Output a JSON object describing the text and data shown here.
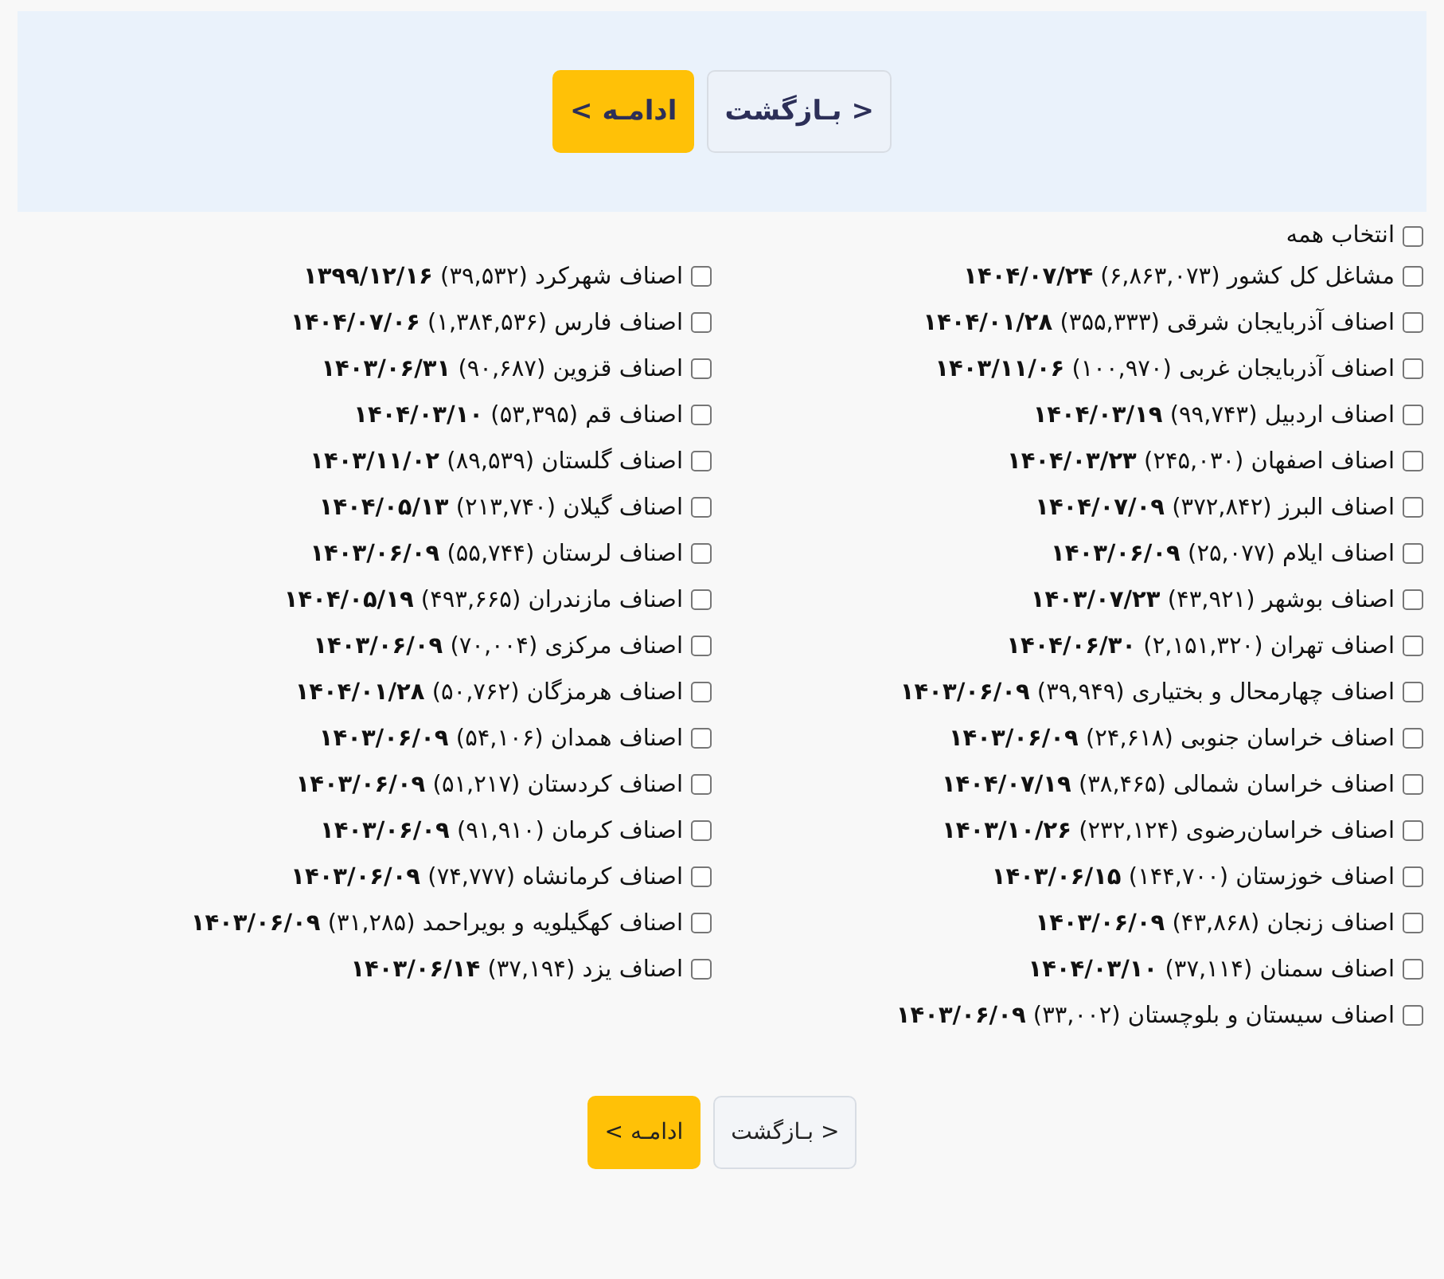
{
  "top_actions": [
    {
      "kind": "back",
      "label": "< بـازگشت"
    },
    {
      "kind": "continue",
      "label": "ادامـه >"
    }
  ],
  "select_all": {
    "label": "انتخاب همه",
    "checked": false
  },
  "columns": [
    {
      "items": [
        {
          "text": "مشاغل کل کشور (۶,۸۶۳,۰۷۳) **۱۴۰۴/۰۷/۲۴**",
          "checked": false
        },
        {
          "text": "اصناف آذربایجان شرقی (۳۵۵,۳۳۳) **۱۴۰۴/۰۱/۲۸**",
          "checked": false
        },
        {
          "text": "اصناف آذربایجان غربی (۱۰۰,۹۷۰) **۱۴۰۳/۱۱/۰۶**",
          "checked": false
        },
        {
          "text": "اصناف اردبیل (۹۹,۷۴۳) **۱۴۰۴/۰۳/۱۹**",
          "checked": false
        },
        {
          "text": "اصناف اصفهان (۲۴۵,۰۳۰) **۱۴۰۴/۰۳/۲۳**",
          "checked": false
        },
        {
          "text": "اصناف البرز (۳۷۲,۸۴۲) **۱۴۰۴/۰۷/۰۹**",
          "checked": false
        },
        {
          "text": "اصناف ایلام (۲۵,۰۷۷) **۱۴۰۳/۰۶/۰۹**",
          "checked": false
        },
        {
          "text": "اصناف بوشهر (۴۳,۹۲۱) **۱۴۰۳/۰۷/۲۳**",
          "checked": false
        },
        {
          "text": "اصناف تهران (۲,۱۵۱,۳۲۰) **۱۴۰۴/۰۶/۳۰**",
          "checked": false
        },
        {
          "text": "اصناف چهارمحال و بختیاری (۳۹,۹۴۹) **۱۴۰۳/۰۶/۰۹**",
          "checked": false
        },
        {
          "text": "اصناف خراسان جنوبی (۲۴,۶۱۸) **۱۴۰۳/۰۶/۰۹**",
          "checked": false
        },
        {
          "text": "اصناف خراسان شمالی (۳۸,۴۶۵) **۱۴۰۴/۰۷/۱۹**",
          "checked": false
        },
        {
          "text": "اصناف خراسان‌رضوی (۲۳۲,۱۲۴) **۱۴۰۳/۱۰/۲۶**",
          "checked": false
        },
        {
          "text": "اصناف خوزستان (۱۴۴,۷۰۰) **۱۴۰۳/۰۶/۱۵**",
          "checked": false
        },
        {
          "text": "اصناف زنجان (۴۳,۸۶۸) **۱۴۰۳/۰۶/۰۹**",
          "checked": false
        },
        {
          "text": "اصناف سمنان (۳۷,۱۱۴) **۱۴۰۴/۰۳/۱۰**",
          "checked": false
        },
        {
          "text": "اصناف سیستان و بلوچستان (۳۳,۰۰۲) **۱۴۰۳/۰۶/۰۹**",
          "checked": false
        }
      ]
    },
    {
      "items": [
        {
          "text": "اصناف شهرکرد (۳۹,۵۳۲) **۱۳۹۹/۱۲/۱۶**",
          "checked": false
        },
        {
          "text": "اصناف فارس (۱,۳۸۴,۵۳۶) **۱۴۰۴/۰۷/۰۶**",
          "checked": false
        },
        {
          "text": "اصناف قزوین (۹۰,۶۸۷) **۱۴۰۳/۰۶/۳۱**",
          "checked": false
        },
        {
          "text": "اصناف قم (۵۳,۳۹۵) **۱۴۰۴/۰۳/۱۰**",
          "checked": false
        },
        {
          "text": "اصناف گلستان (۸۹,۵۳۹) **۱۴۰۳/۱۱/۰۲**",
          "checked": false
        },
        {
          "text": "اصناف گیلان (۲۱۳,۷۴۰) **۱۴۰۴/۰۵/۱۳**",
          "checked": false
        },
        {
          "text": "اصناف لرستان (۵۵,۷۴۴) **۱۴۰۳/۰۶/۰۹**",
          "checked": false
        },
        {
          "text": "اصناف مازندران (۴۹۳,۶۶۵) **۱۴۰۴/۰۵/۱۹**",
          "checked": false
        },
        {
          "text": "اصناف مرکزی (۷۰,۰۰۴) **۱۴۰۳/۰۶/۰۹**",
          "checked": false
        },
        {
          "text": "اصناف هرمزگان (۵۰,۷۶۲) **۱۴۰۴/۰۱/۲۸**",
          "checked": false
        },
        {
          "text": "اصناف همدان (۵۴,۱۰۶) **۱۴۰۳/۰۶/۰۹**",
          "checked": false
        },
        {
          "text": "اصناف کردستان (۵۱,۲۱۷) **۱۴۰۳/۰۶/۰۹**",
          "checked": false
        },
        {
          "text": "اصناف کرمان (۹۱,۹۱۰) **۱۴۰۳/۰۶/۰۹**",
          "checked": false
        },
        {
          "text": "اصناف کرمانشاه (۷۴,۷۷۷) **۱۴۰۳/۰۶/۰۹**",
          "checked": false
        },
        {
          "text": "اصناف کهگیلویه و بویراحمد (۳۱,۲۸۵) **۱۴۰۳/۰۶/۰۹**",
          "checked": false
        },
        {
          "text": "اصناف یزد (۳۷,۱۹۴) **۱۴۰۳/۰۶/۱۴**",
          "checked": false
        }
      ]
    }
  ],
  "bottom_actions": [
    {
      "kind": "back",
      "label": "< بـازگشت"
    },
    {
      "kind": "continue",
      "label": "ادامـه >"
    }
  ]
}
